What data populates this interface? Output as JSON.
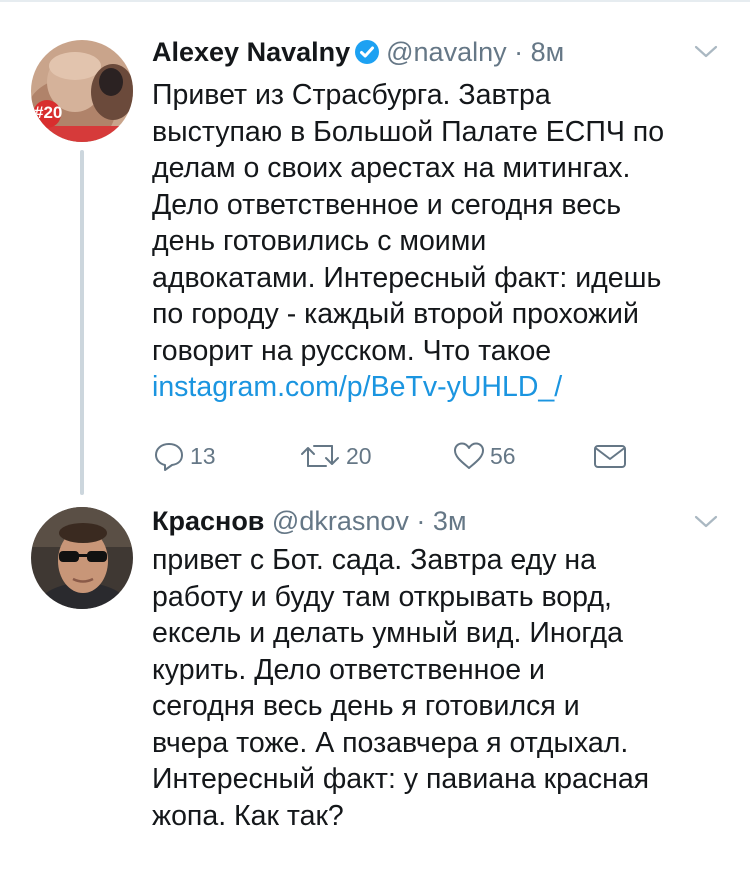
{
  "tweets": [
    {
      "name": "Alexey Navalny",
      "handle": "@navalny",
      "separator": "·",
      "time": "8м",
      "avatar_badge": "#20",
      "lines": [
        "Привет из Страсбурга. Завтра",
        "выступаю в Большой Палате ЕСПЧ по",
        "делам о своих арестах на митингах.",
        "Дело ответственное и сегодня весь",
        "день готовились с моими",
        "адвокатами. Интересный факт: идешь",
        "по городу - каждый второй прохожий",
        "говорит на русском. Что такое"
      ],
      "link": "instagram.com/p/BeTv-yUHLD_/",
      "replies": "13",
      "retweets": "20",
      "likes": "56"
    },
    {
      "name": "Краснов",
      "handle": "@dkrasnov",
      "separator": "·",
      "time": "3м",
      "lines": [
        "привет с Бот. сада. Завтра еду на",
        "работу и буду там открывать ворд,",
        "ексель и делать умный вид. Иногда",
        "курить. Дело ответственное и",
        "сегодня весь день я готовился и",
        "вчера тоже. А позавчера я отдыхал.",
        "Интересный факт: у павиана красная",
        "жопа. Как так?"
      ]
    }
  ],
  "icons": {
    "verified": "verified-badge-icon",
    "caret": "chevron-down-icon",
    "reply": "reply-icon",
    "retweet": "retweet-icon",
    "like": "heart-icon",
    "dm": "envelope-icon"
  },
  "colors": {
    "link": "#1b95e0",
    "secondary": "#657786",
    "verified": "#1da1f2",
    "thread_line": "#ccd6dd"
  }
}
